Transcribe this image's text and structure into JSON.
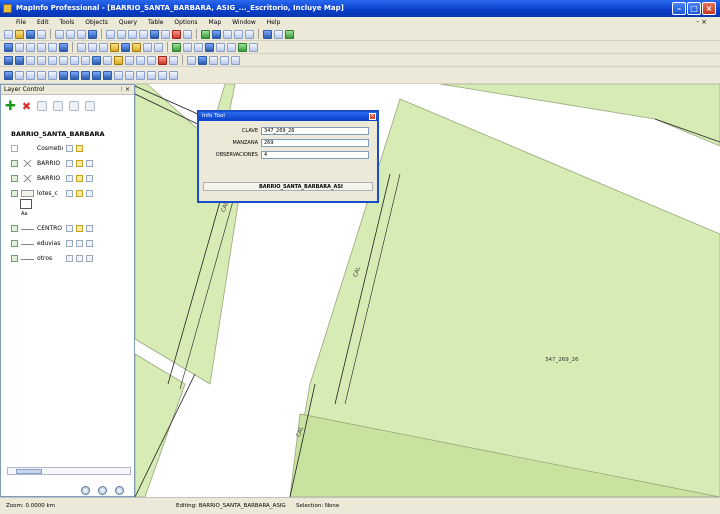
{
  "app": {
    "title": "MapInfo Professional - [BARRIO_SANTA_BARBARA, ASIG_..._Escritorio, Incluye Map]",
    "icon": "mapinfo-app-icon"
  },
  "menu": [
    "File",
    "Edit",
    "Tools",
    "Objects",
    "Query",
    "Table",
    "Options",
    "Map",
    "Window",
    "Help"
  ],
  "layer_control": {
    "title": "Layer Control",
    "map_name": "BARRIO_SANTA_BARBARA",
    "layers": [
      {
        "name": "Cosmetic",
        "symbol": "none",
        "checked": false
      },
      {
        "name": "BARRIO",
        "symbol": "x",
        "checked": true
      },
      {
        "name": "BARRIO",
        "symbol": "x",
        "checked": true
      },
      {
        "name": "lotes_c",
        "symbol": "box",
        "checked": true
      },
      {
        "name": "CENTRO",
        "symbol": "line",
        "checked": true
      },
      {
        "name": "eduvias",
        "symbol": "line",
        "checked": true
      },
      {
        "name": "otros",
        "symbol": "line",
        "checked": true
      }
    ],
    "legend_label": "Aa"
  },
  "info_tool": {
    "title": "Info Tool",
    "fields": [
      {
        "label": "CLAVE",
        "value": "347_269_26"
      },
      {
        "label": "MANZANA",
        "value": "269"
      },
      {
        "label": "OBSERVACIONES",
        "value": "4"
      }
    ],
    "footer": "BARRIO_SANTA_BARBARA_ASI"
  },
  "map": {
    "parcel_label": "347_269_26",
    "road_label_1": "CAL",
    "road_label_2": "CAL",
    "road_label_3": "CAL"
  },
  "status": {
    "zoom": "Zoom: 0.0000 km",
    "editing": "Editing: BARRIO_SANTA_BARBARA_ASIG",
    "selection": "Selection: None"
  },
  "colors": {
    "parcel_fill": "#d6ecb4",
    "parcel_stroke": "#9aa57a",
    "titlebar": "#0a3fc8"
  }
}
